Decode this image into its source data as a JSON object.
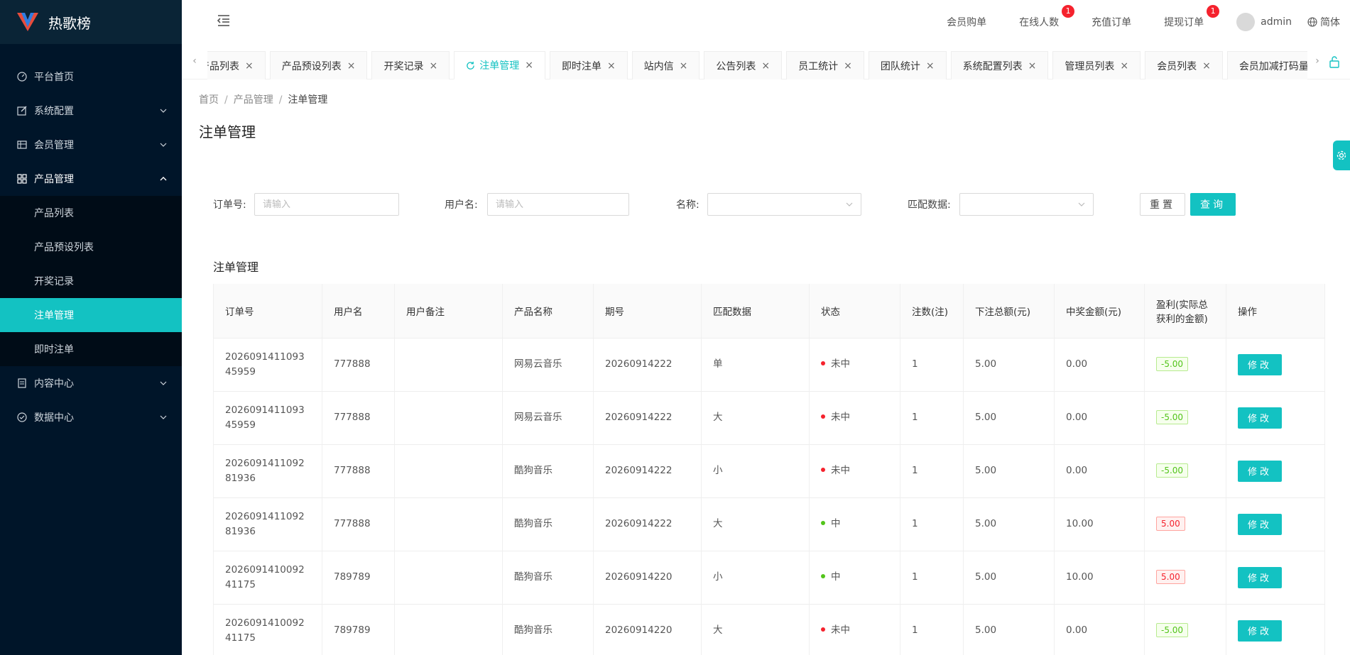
{
  "app": {
    "title": "热歌榜"
  },
  "colors": {
    "accent": "#13c2c2",
    "sidebar_bg": "#001529",
    "loss": "#52c41a",
    "win": "#f5222d"
  },
  "sidebar": {
    "items": [
      {
        "label": "平台首页",
        "icon": "dashboard-icon"
      },
      {
        "label": "系统配置",
        "icon": "edit-icon"
      },
      {
        "label": "会员管理",
        "icon": "table-icon"
      },
      {
        "label": "产品管理",
        "icon": "grid-icon"
      },
      {
        "label": "内容中心",
        "icon": "document-icon"
      },
      {
        "label": "数据中心",
        "icon": "check-circle-icon"
      }
    ],
    "sub_items": [
      {
        "label": "产品列表"
      },
      {
        "label": "产品预设列表"
      },
      {
        "label": "开奖记录"
      },
      {
        "label": "注单管理"
      },
      {
        "label": "即时注单"
      }
    ]
  },
  "header": {
    "links": [
      {
        "label": "会员购单"
      },
      {
        "label": "在线人数",
        "badge": "1"
      },
      {
        "label": "充值订单"
      },
      {
        "label": "提现订单",
        "badge": "1"
      }
    ],
    "user": "admin",
    "lang": "简体"
  },
  "tabs": [
    {
      "label": "产品列表"
    },
    {
      "label": "产品预设列表"
    },
    {
      "label": "开奖记录"
    },
    {
      "label": "注单管理"
    },
    {
      "label": "即时注单"
    },
    {
      "label": "站内信"
    },
    {
      "label": "公告列表"
    },
    {
      "label": "员工统计"
    },
    {
      "label": "团队统计"
    },
    {
      "label": "系统配置列表"
    },
    {
      "label": "管理员列表"
    },
    {
      "label": "会员列表"
    },
    {
      "label": "会员加减打码量"
    }
  ],
  "breadcrumb": {
    "home": "首页",
    "parent": "产品管理",
    "current": "注单管理"
  },
  "page_title": "注单管理",
  "filter": {
    "order_label": "订单号:",
    "order_placeholder": "请输入",
    "user_label": "用户名:",
    "user_placeholder": "请输入",
    "name_label": "名称:",
    "match_label": "匹配数据:",
    "reset_label": "重置",
    "search_label": "查询"
  },
  "section_title": "注单管理",
  "table": {
    "headers": [
      "订单号",
      "用户名",
      "用户备注",
      "产品名称",
      "期号",
      "匹配数据",
      "状态",
      "注数(注)",
      "下注总额(元)",
      "中奖金额(元)",
      "盈利(实际总获利的金额)",
      "操作"
    ],
    "edit_label": "修改",
    "rows": [
      {
        "order": "202609141109345959",
        "user": "777888",
        "note": "",
        "product": "网易云音乐",
        "period": "20260914222",
        "match": "单",
        "status": "未中",
        "win": false,
        "count": "1",
        "bet": "5.00",
        "prize": "0.00",
        "profit": "-5.00"
      },
      {
        "order": "202609141109345959",
        "user": "777888",
        "note": "",
        "product": "网易云音乐",
        "period": "20260914222",
        "match": "大",
        "status": "未中",
        "win": false,
        "count": "1",
        "bet": "5.00",
        "prize": "0.00",
        "profit": "-5.00"
      },
      {
        "order": "202609141109281936",
        "user": "777888",
        "note": "",
        "product": "酷狗音乐",
        "period": "20260914222",
        "match": "小",
        "status": "未中",
        "win": false,
        "count": "1",
        "bet": "5.00",
        "prize": "0.00",
        "profit": "-5.00"
      },
      {
        "order": "202609141109281936",
        "user": "777888",
        "note": "",
        "product": "酷狗音乐",
        "period": "20260914222",
        "match": "大",
        "status": "中",
        "win": true,
        "count": "1",
        "bet": "5.00",
        "prize": "10.00",
        "profit": "5.00"
      },
      {
        "order": "202609141009241175",
        "user": "789789",
        "note": "",
        "product": "酷狗音乐",
        "period": "20260914220",
        "match": "小",
        "status": "中",
        "win": true,
        "count": "1",
        "bet": "5.00",
        "prize": "10.00",
        "profit": "5.00"
      },
      {
        "order": "202609141009241175",
        "user": "789789",
        "note": "",
        "product": "酷狗音乐",
        "period": "20260914220",
        "match": "大",
        "status": "未中",
        "win": false,
        "count": "1",
        "bet": "5.00",
        "prize": "0.00",
        "profit": "-5.00"
      }
    ]
  }
}
